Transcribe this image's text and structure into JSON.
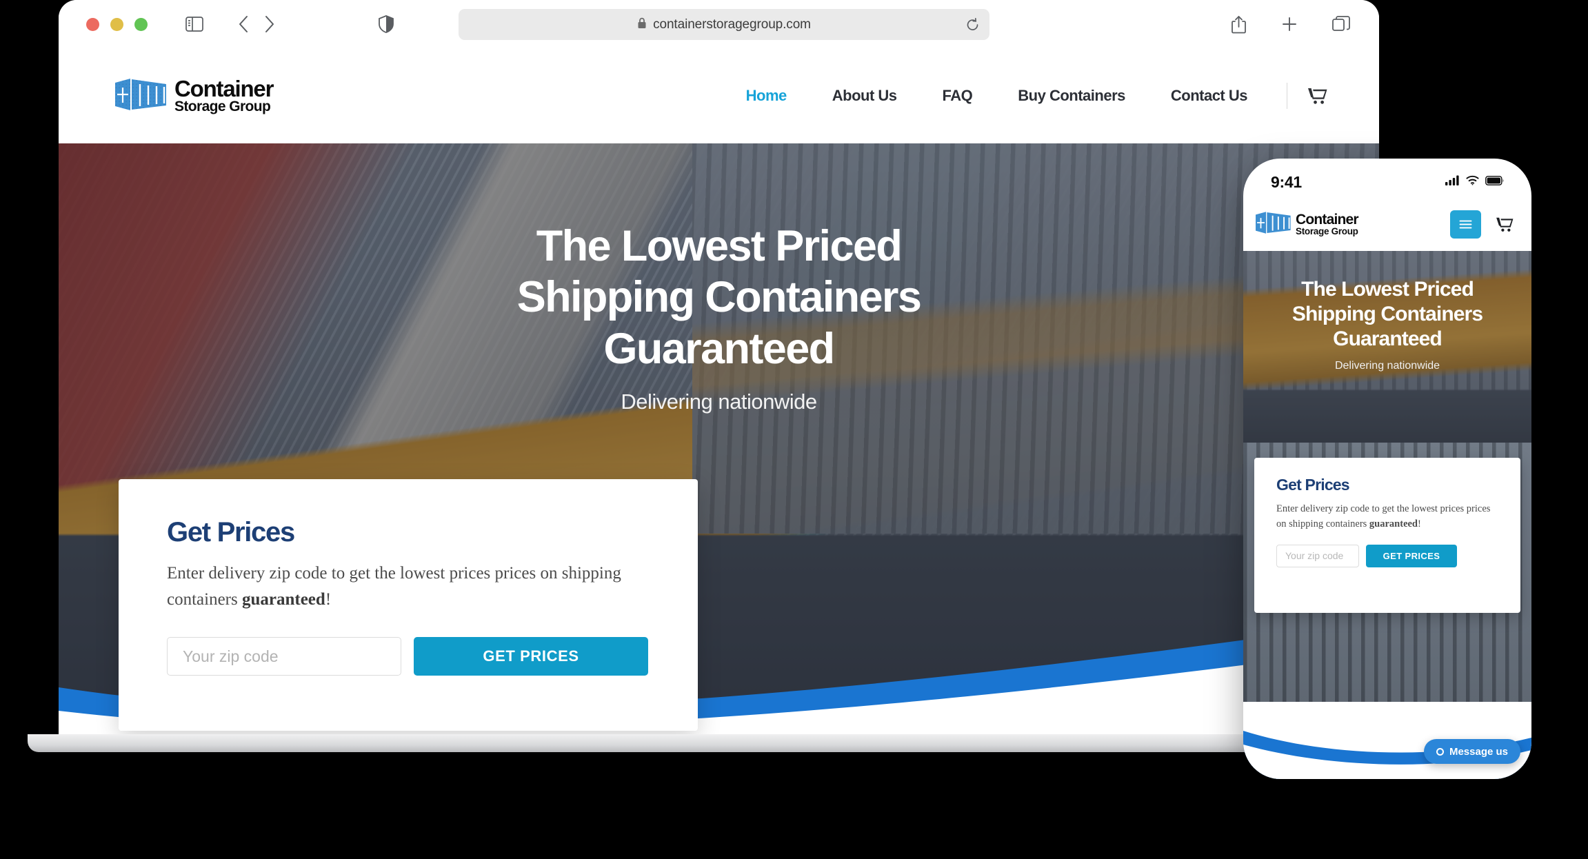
{
  "browser": {
    "url": "containerstoragegroup.com",
    "lock_icon": "lock-icon",
    "traffic_lights": [
      "close-red",
      "minimize-yellow",
      "zoom-green"
    ],
    "sidebar_icon": "sidebar-icon",
    "back_icon": "chevron-left-icon",
    "forward_icon": "chevron-right-icon",
    "shield_icon": "shield-icon",
    "reload_icon": "reload-icon",
    "share_icon": "share-icon",
    "new_tab_icon": "plus-icon",
    "tabs_icon": "tab-overview-icon"
  },
  "site": {
    "logo": {
      "line1": "Container",
      "line2": "Storage Group",
      "mark": "shipping-container-icon"
    },
    "nav": [
      {
        "label": "Home",
        "active": true
      },
      {
        "label": "About Us",
        "active": false
      },
      {
        "label": "FAQ",
        "active": false
      },
      {
        "label": "Buy Containers",
        "active": false
      },
      {
        "label": "Contact Us",
        "active": false
      }
    ],
    "cart_icon": "shopping-cart-icon",
    "hero": {
      "line1": "The Lowest Priced",
      "line2": "Shipping Containers",
      "line3": "Guaranteed",
      "subtitle": "Delivering nationwide"
    },
    "price_card": {
      "title": "Get Prices",
      "body_prefix": "Enter delivery zip code to get the lowest prices prices on shipping containers ",
      "body_bold": "guaranteed",
      "body_suffix": "!",
      "zip_placeholder": "Your zip code",
      "zip_value": "",
      "submit_label": "GET PRICES"
    }
  },
  "phone": {
    "status": {
      "time": "9:41",
      "signal_icon": "cellular-signal-icon",
      "wifi_icon": "wifi-icon",
      "battery_icon": "battery-icon"
    },
    "logo": {
      "line1": "Container",
      "line2": "Storage Group",
      "mark": "shipping-container-icon"
    },
    "menu_icon": "hamburger-menu-icon",
    "cart_icon": "shopping-cart-icon",
    "hero": {
      "line1": "The Lowest Priced",
      "line2": "Shipping Containers",
      "line3": "Guaranteed",
      "subtitle": "Delivering nationwide"
    },
    "price_card": {
      "title": "Get Prices",
      "body_prefix": "Enter delivery zip code to get the lowest prices prices on shipping containers ",
      "body_bold": "guaranteed",
      "body_suffix": "!",
      "zip_placeholder": "Your zip code",
      "zip_value": "",
      "submit_label": "GET PRICES"
    },
    "chat": {
      "label": "Message us",
      "icon": "chat-circle-icon"
    }
  },
  "colors": {
    "accent_cyan": "#109cc9",
    "nav_active": "#16a3d8",
    "card_title_navy": "#1d3f75",
    "wave_blue": "#1a75d1",
    "chat_blue": "#2b86d9",
    "logo_blue": "#3d8fd1"
  }
}
